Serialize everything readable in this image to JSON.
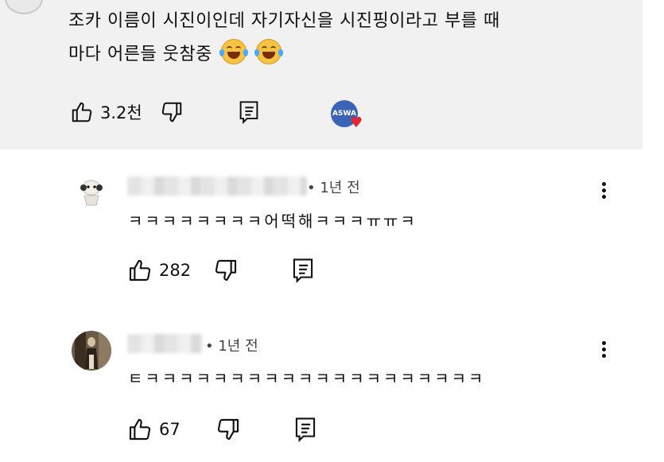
{
  "top_comment": {
    "text_line1": "조카 이름이 시진이인데 자기자신을 시진핑이라고 부를 때",
    "text_line2": "마다 어른들 웃참중",
    "like_count": "3.2천",
    "creator_badge_text": "ASWA"
  },
  "replies": [
    {
      "time": "• 1년 전",
      "text": "ㅋㅋㅋㅋㅋㅋㅋㅋ어떡해ㅋㅋㅋㅠㅠㅋ",
      "like_count": "282"
    },
    {
      "time": "• 1년 전",
      "text": "ㅌㅋㅋㅋㅋㅋㅋㅋㅋㅋㅋㅋㅋㅋㅋㅋㅋㅋㅋㅋㅋ",
      "like_count": "67"
    }
  ],
  "colors": {
    "top_bg": "#f1f1f1",
    "heart": "#e0282e",
    "badge": "#3b63b8"
  }
}
